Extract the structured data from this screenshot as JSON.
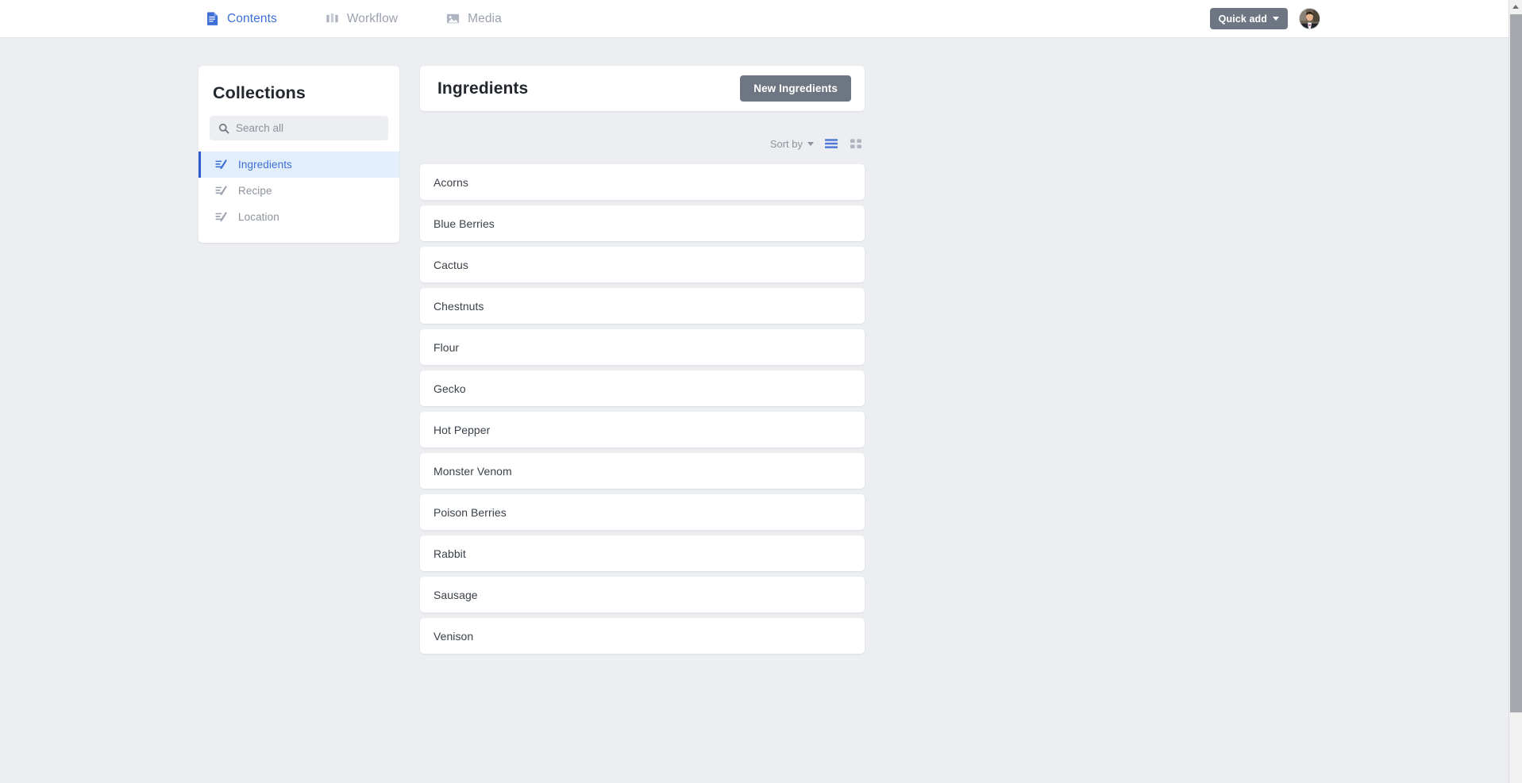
{
  "header": {
    "nav": [
      {
        "label": "Contents",
        "icon": "document-icon",
        "active": true
      },
      {
        "label": "Workflow",
        "icon": "columns-icon",
        "active": false
      },
      {
        "label": "Media",
        "icon": "image-icon",
        "active": false
      }
    ],
    "quick_add": {
      "label": "Quick add",
      "icon": "chevron-down-icon"
    },
    "avatar": {
      "name": "user-avatar"
    }
  },
  "sidebar": {
    "title": "Collections",
    "search": {
      "placeholder": "Search all",
      "value": "",
      "icon": "search-icon"
    },
    "items": [
      {
        "label": "Ingredients",
        "icon": "edit-list-icon",
        "active": true
      },
      {
        "label": "Recipe",
        "icon": "edit-list-icon",
        "active": false
      },
      {
        "label": "Location",
        "icon": "edit-list-icon",
        "active": false
      }
    ]
  },
  "main": {
    "title": "Ingredients",
    "new_button": "New Ingredients",
    "toolbar": {
      "sort_label": "Sort by",
      "sort_caret": "chevron-down-icon",
      "list_view": {
        "icon": "list-view-icon",
        "active": true
      },
      "grid_view": {
        "icon": "grid-view-icon",
        "active": false
      }
    },
    "items": [
      "Acorns",
      "Blue Berries",
      "Cactus",
      "Chestnuts",
      "Flour",
      "Gecko",
      "Hot Pepper",
      "Monster Venom",
      "Poison Berries",
      "Rabbit",
      "Sausage",
      "Venison"
    ]
  },
  "colors": {
    "page_background": "#eceef1",
    "card_background": "#ffffff",
    "accent_blue": "#3d6fd6",
    "active_item_background": "#e2eefb",
    "active_item_border": "#2f5bd0",
    "button_gray": "#6f7683",
    "muted_text": "#8d939c",
    "body_text": "#3a4149"
  },
  "scrollbar": {
    "name": "page-scrollbar"
  }
}
